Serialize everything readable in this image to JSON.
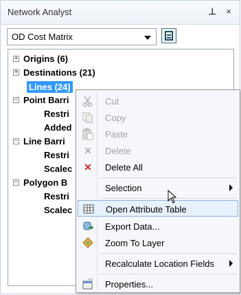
{
  "window": {
    "title": "Network Analyst",
    "pin_icon": "pin-icon",
    "close_label": "×"
  },
  "layer_select": {
    "value": "OD Cost Matrix",
    "button_icon": "network-analyst-window-icon"
  },
  "tree": {
    "items": [
      {
        "label": "Origins (6)",
        "expander": "+",
        "selected": false
      },
      {
        "label": "Destinations (21)",
        "expander": "+",
        "selected": false
      },
      {
        "label": "Lines (24)",
        "expander": "",
        "selected": true
      },
      {
        "label": "Point Barri",
        "expander": "−",
        "selected": false
      },
      {
        "label": "Restri",
        "expander": "",
        "selected": false
      },
      {
        "label": "Added",
        "expander": "",
        "selected": false
      },
      {
        "label": "Line Barri",
        "expander": "−",
        "selected": false
      },
      {
        "label": "Restri",
        "expander": "",
        "selected": false
      },
      {
        "label": "Scalec",
        "expander": "",
        "selected": false
      },
      {
        "label": "Polygon B",
        "expander": "−",
        "selected": false
      },
      {
        "label": "Restri",
        "expander": "",
        "selected": false
      },
      {
        "label": "Scalec",
        "expander": "",
        "selected": false
      }
    ]
  },
  "context_menu": {
    "items": [
      {
        "label": "Cut",
        "icon": "cut-icon",
        "enabled": false
      },
      {
        "label": "Copy",
        "icon": "copy-icon",
        "enabled": false
      },
      {
        "label": "Paste",
        "icon": "paste-icon",
        "enabled": false
      },
      {
        "label": "Delete",
        "icon": "delete-icon",
        "enabled": false
      },
      {
        "label": "Delete All",
        "icon": "delete-all-icon",
        "enabled": true
      },
      {
        "label": "Selection",
        "icon": "",
        "enabled": true,
        "submenu": true
      },
      {
        "label": "Open Attribute Table",
        "icon": "attribute-table-icon",
        "enabled": true,
        "highlighted": true
      },
      {
        "label": "Export Data...",
        "icon": "export-data-icon",
        "enabled": true
      },
      {
        "label": "Zoom To Layer",
        "icon": "zoom-to-layer-icon",
        "enabled": true
      },
      {
        "label": "Recalculate Location Fields",
        "icon": "",
        "enabled": true,
        "submenu": true
      },
      {
        "label": "Properties...",
        "icon": "properties-icon",
        "enabled": true
      }
    ]
  },
  "colors": {
    "selection_bg": "#3399ff",
    "menu_highlight_bg": "#e7f1fb",
    "menu_highlight_border": "#8db2e3",
    "delete_all_icon": "#d22424"
  }
}
